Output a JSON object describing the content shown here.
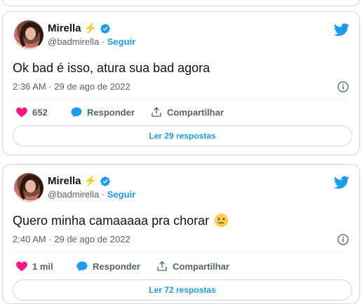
{
  "tweets": [
    {
      "author_name": "Mirella",
      "author_emoji": "⚡",
      "handle": "@badmirella",
      "separator": "·",
      "follow_label": "Seguir",
      "text": "Ok bad é isso, atura sua bad agora",
      "timestamp": "2:36 AM · 29 de ago de 2022",
      "likes": "652",
      "reply_label": "Responder",
      "share_label": "Compartilhar",
      "read_replies_label": "Ler 29 respostas"
    },
    {
      "author_name": "Mirella",
      "author_emoji": "⚡",
      "handle": "@badmirella",
      "separator": "·",
      "follow_label": "Seguir",
      "text": "Quero minha camaaaaa pra chorar",
      "trailing_emoji": "crying-face-emoji",
      "timestamp": "2:40 AM · 29 de ago de 2022",
      "likes": "1 mil",
      "reply_label": "Responder",
      "share_label": "Compartilhar",
      "read_replies_label": "Ler 72 respostas"
    }
  ],
  "colors": {
    "accent": "#1d9bf0",
    "like": "#f91880",
    "muted": "#536471",
    "border": "#cfd9de"
  },
  "icons": [
    "verified-badge-icon",
    "twitter-bird-icon",
    "info-icon",
    "heart-icon",
    "reply-bubble-icon",
    "share-icon"
  ]
}
